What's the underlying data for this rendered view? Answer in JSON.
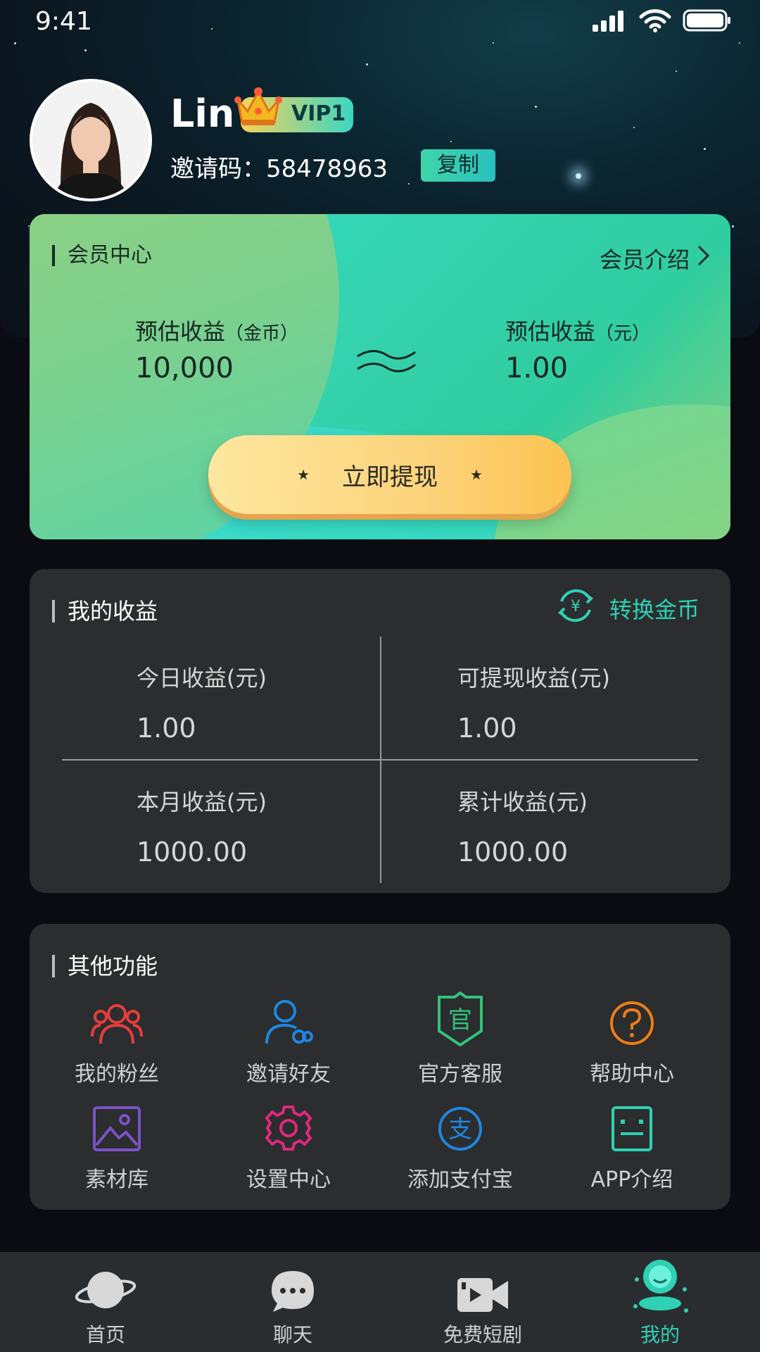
{
  "status_bar": {
    "time": "9:41"
  },
  "profile": {
    "name": "Lin",
    "vip_badge": "VIP1",
    "invite_label": "邀请码：",
    "invite_code": "58478963",
    "copy_label": "复制"
  },
  "member_card": {
    "title": "会员中心",
    "link_label": "会员介绍",
    "left": {
      "label": "预估收益",
      "unit": "（金币）",
      "value": "10,000"
    },
    "right": {
      "label": "预估收益",
      "unit": "（元）",
      "value": "1.00"
    },
    "withdraw_label": "立即提现"
  },
  "earnings": {
    "title": "我的收益",
    "convert_label": "转换金币",
    "cells": [
      {
        "label": "今日收益(元)",
        "value": "1.00"
      },
      {
        "label": "可提现收益(元)",
        "value": "1.00"
      },
      {
        "label": "本月收益(元)",
        "value": "1000.00"
      },
      {
        "label": "累计收益(元)",
        "value": "1000.00"
      }
    ]
  },
  "functions": {
    "title": "其他功能",
    "items": [
      {
        "label": "我的粉丝",
        "icon": "fans-icon",
        "color": "#e83c3c"
      },
      {
        "label": "邀请好友",
        "icon": "invite-friend-icon",
        "color": "#1f86e0"
      },
      {
        "label": "官方客服",
        "icon": "official-service-icon",
        "color": "#33c27b"
      },
      {
        "label": "帮助中心",
        "icon": "help-icon",
        "color": "#ef7d16"
      },
      {
        "label": "素材库",
        "icon": "image-library-icon",
        "color": "#7b52c7"
      },
      {
        "label": "设置中心",
        "icon": "settings-gear-icon",
        "color": "#e0287f"
      },
      {
        "label": "添加支付宝",
        "icon": "alipay-icon",
        "color": "#1f86e0"
      },
      {
        "label": "APP介绍",
        "icon": "app-intro-icon",
        "color": "#2ed1b3"
      }
    ]
  },
  "tabbar": {
    "items": [
      {
        "label": "首页",
        "icon": "planet-icon"
      },
      {
        "label": "聊天",
        "icon": "chat-bubble-icon"
      },
      {
        "label": "免费短剧",
        "icon": "video-camera-icon"
      },
      {
        "label": "我的",
        "icon": "profile-icon",
        "active": true
      }
    ],
    "active_color": "#2ed1b3"
  }
}
